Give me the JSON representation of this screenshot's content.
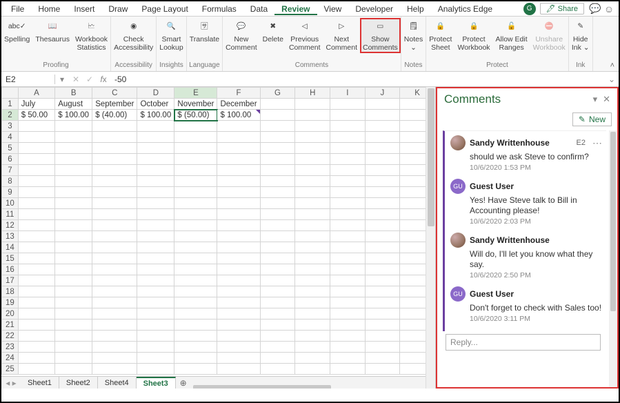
{
  "menu": {
    "items": [
      "File",
      "Home",
      "Insert",
      "Draw",
      "Page Layout",
      "Formulas",
      "Data",
      "Review",
      "View",
      "Developer",
      "Help",
      "Analytics Edge"
    ],
    "active": "Review",
    "account_initial": "G",
    "share_label": "Share"
  },
  "ribbon": {
    "groups": [
      {
        "label": "Proofing",
        "buttons": [
          {
            "name": "spelling",
            "label": "Spelling",
            "glyph": "abc✓"
          },
          {
            "name": "thesaurus",
            "label": "Thesaurus",
            "glyph": "📖"
          },
          {
            "name": "workbook-stats",
            "label": "Workbook\nStatistics",
            "glyph": "🗠"
          }
        ]
      },
      {
        "label": "Accessibility",
        "buttons": [
          {
            "name": "check-accessibility",
            "label": "Check\nAccessibility",
            "glyph": "◉"
          }
        ]
      },
      {
        "label": "Insights",
        "buttons": [
          {
            "name": "smart-lookup",
            "label": "Smart\nLookup",
            "glyph": "🔍"
          }
        ]
      },
      {
        "label": "Language",
        "buttons": [
          {
            "name": "translate",
            "label": "Translate",
            "glyph": "🈂"
          }
        ]
      },
      {
        "label": "Comments",
        "buttons": [
          {
            "name": "new-comment",
            "label": "New\nComment",
            "glyph": "💬"
          },
          {
            "name": "delete-comment",
            "label": "Delete",
            "glyph": "✖"
          },
          {
            "name": "previous-comment",
            "label": "Previous\nComment",
            "glyph": "◁"
          },
          {
            "name": "next-comment",
            "label": "Next\nComment",
            "glyph": "▷"
          },
          {
            "name": "show-comments",
            "label": "Show\nComments",
            "glyph": "▭",
            "highlight": true
          }
        ]
      },
      {
        "label": "Notes",
        "buttons": [
          {
            "name": "notes",
            "label": "Notes\n⌄",
            "glyph": "🗒"
          }
        ]
      },
      {
        "label": "Protect",
        "buttons": [
          {
            "name": "protect-sheet",
            "label": "Protect\nSheet",
            "glyph": "🔒"
          },
          {
            "name": "protect-workbook",
            "label": "Protect\nWorkbook",
            "glyph": "🔒"
          },
          {
            "name": "allow-edit-ranges",
            "label": "Allow Edit\nRanges",
            "glyph": "🔓"
          },
          {
            "name": "unshare-workbook",
            "label": "Unshare\nWorkbook",
            "glyph": "⛔",
            "disabled": true
          }
        ]
      },
      {
        "label": "Ink",
        "buttons": [
          {
            "name": "hide-ink",
            "label": "Hide\nInk ⌄",
            "glyph": "✎"
          }
        ]
      }
    ]
  },
  "formula": {
    "name": "E2",
    "value": "-50"
  },
  "grid": {
    "cols": [
      "A",
      "B",
      "C",
      "D",
      "E",
      "F",
      "G",
      "H",
      "I",
      "J",
      "K"
    ],
    "rows": 25,
    "selected": {
      "row": 2,
      "col": "E"
    },
    "data": {
      "1": {
        "A": "July",
        "B": "August",
        "C": "September",
        "D": "October",
        "E": "November",
        "F": "December"
      },
      "2": {
        "A": "$   50.00",
        "B": "$ 100.00",
        "C": "$   (40.00)",
        "D": "$ 100.00",
        "E": "$   (50.00)",
        "F": "$ 100.00"
      }
    },
    "comment_cell": "F2"
  },
  "tabs": {
    "items": [
      "Sheet1",
      "Sheet2",
      "Sheet4",
      "Sheet3"
    ],
    "active": "Sheet3"
  },
  "comments": {
    "title": "Comments",
    "new_label": "New",
    "cellref": "E2",
    "thread": [
      {
        "avatar": "img",
        "name": "Sandy Writtenhouse",
        "msg": "should we ask Steve to confirm?",
        "ts": "10/6/2020 1:53 PM",
        "first": true
      },
      {
        "avatar": "GU",
        "name": "Guest User",
        "msg": "Yes! Have Steve talk to Bill in Accounting please!",
        "ts": "10/6/2020 2:03 PM"
      },
      {
        "avatar": "img",
        "name": "Sandy Writtenhouse",
        "msg": "Will do, I'll let you know what they say.",
        "ts": "10/6/2020 2:50 PM"
      },
      {
        "avatar": "GU",
        "name": "Guest User",
        "msg": "Don't forget to check with Sales too!",
        "ts": "10/6/2020 3:11 PM"
      }
    ],
    "reply_placeholder": "Reply..."
  }
}
